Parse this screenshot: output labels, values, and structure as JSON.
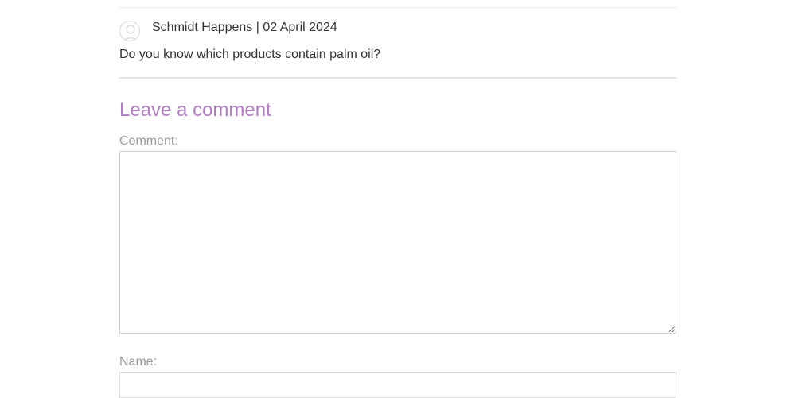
{
  "comment": {
    "author": "Schmidt Happens",
    "separator": "|",
    "date": "02 April 2024",
    "header": "Schmidt Happens | 02 April 2024",
    "text": "Do you know which products contain palm oil?",
    "avatar_icon": "user-avatar-icon"
  },
  "form": {
    "title": "Leave a comment",
    "comment_label": "Comment:",
    "comment_value": "",
    "name_label": "Name:",
    "name_value": ""
  },
  "colors": {
    "accent": "#b07fc2",
    "text": "#333333",
    "label": "#9a9a9a",
    "border": "#cfcfcf"
  }
}
